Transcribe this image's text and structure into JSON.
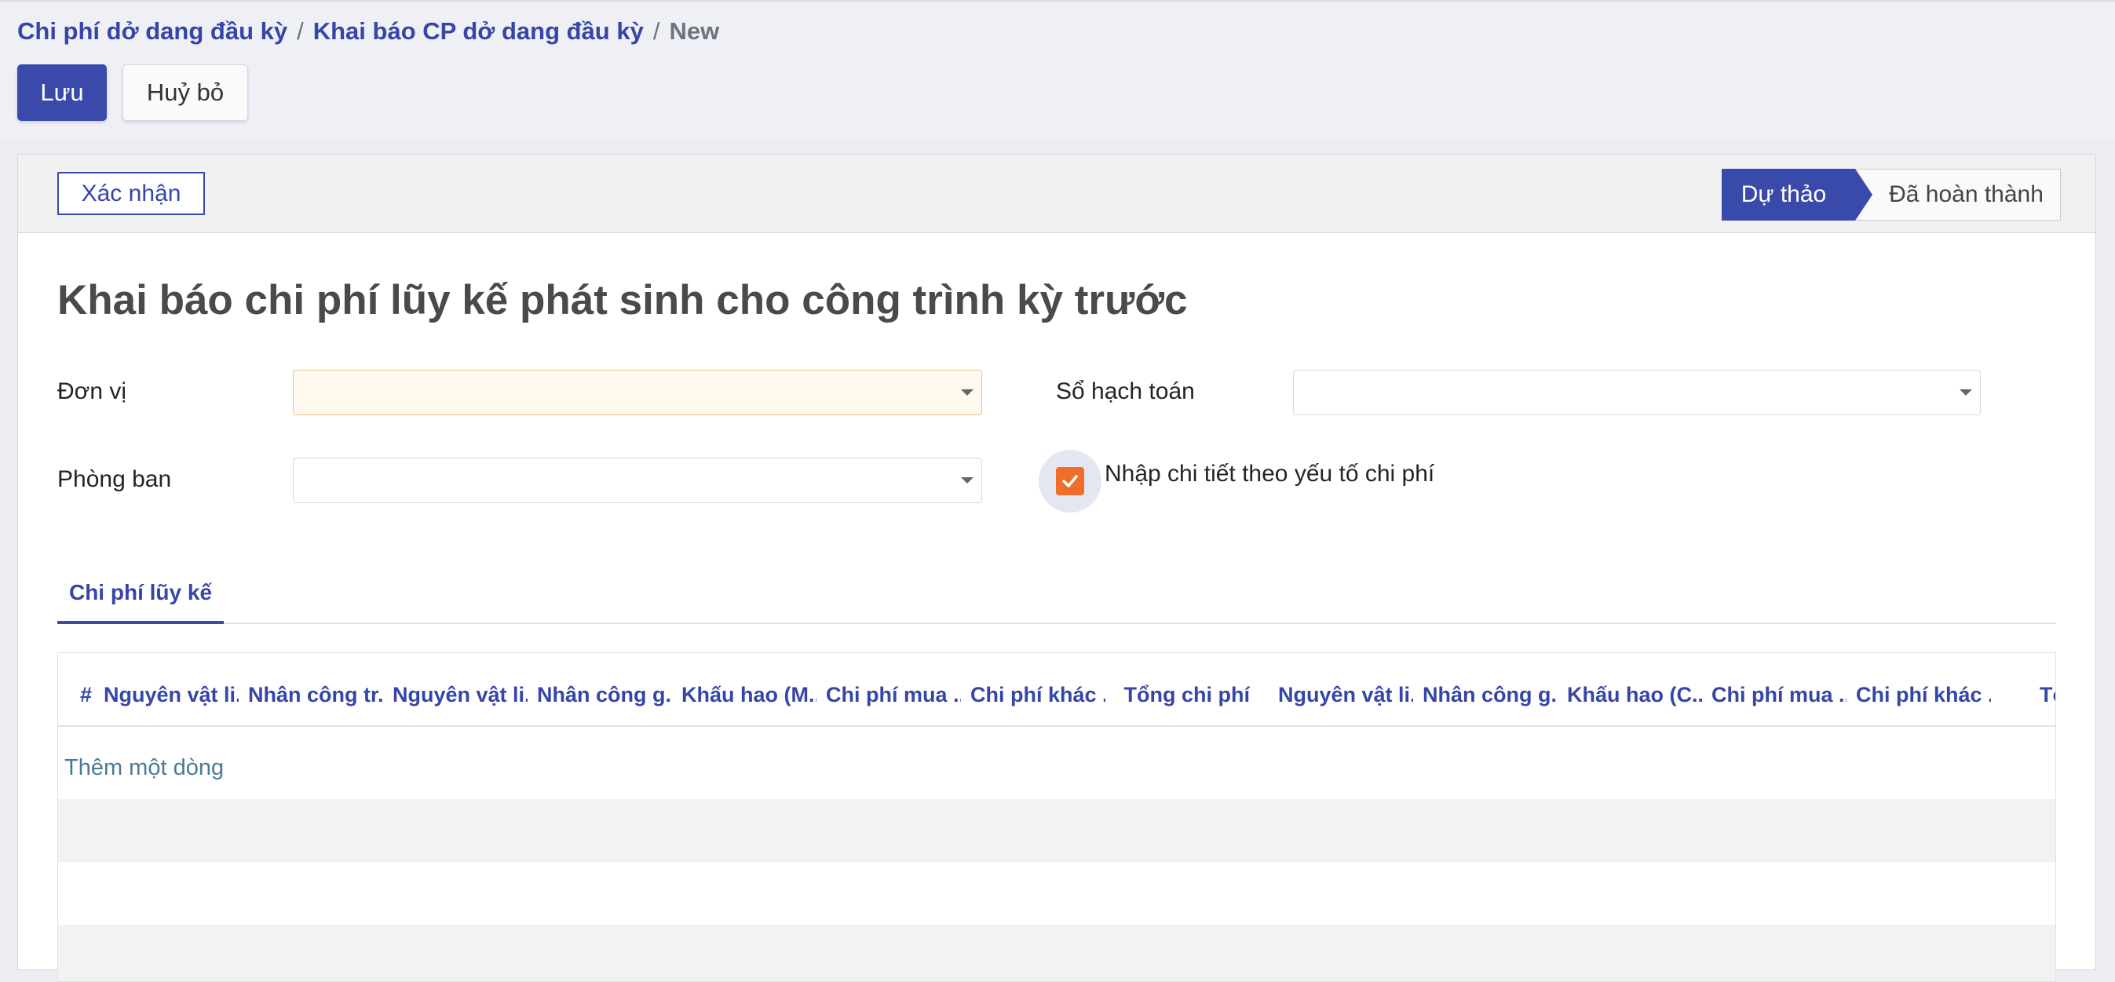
{
  "breadcrumb": {
    "items": [
      "Chi phí dở dang đầu kỳ",
      "Khai báo CP dở dang đầu kỳ"
    ],
    "separator": "/",
    "current": "New"
  },
  "toolbar": {
    "save_label": "Lưu",
    "discard_label": "Huỷ bỏ"
  },
  "statusbar": {
    "confirm_label": "Xác nhận",
    "stages": [
      "Dự thảo",
      "Đã hoàn thành"
    ],
    "active_stage": "Dự thảo"
  },
  "form": {
    "title": "Khai báo chi phí lũy kế phát sinh cho công trình kỳ trước",
    "fields": {
      "don_vi": {
        "label": "Đơn vị",
        "value": "",
        "required": true
      },
      "so_hach_toan": {
        "label": "Sổ hạch toán",
        "value": ""
      },
      "phong_ban": {
        "label": "Phòng ban",
        "value": ""
      },
      "nhap_chi_tiet": {
        "label": "Nhập chi tiết theo yếu tố chi phí",
        "checked": true
      }
    }
  },
  "tabs": [
    {
      "label": "Chi phí lũy kế",
      "active": true
    }
  ],
  "table": {
    "columns": [
      "#",
      "Nguyên vật li...",
      "Nhân công tr...",
      "Nguyên vật li...",
      "Nhân công g...",
      "Khấu hao (M...",
      "Chi phí mua ...",
      "Chi phí khác ...",
      "Tổng chi phí",
      "Nguyên vật li...",
      "Nhân công g...",
      "Khấu hao (C...",
      "Chi phí mua ...",
      "Chi phí khác ...",
      "Tổ"
    ],
    "add_line_label": "Thêm một dòng",
    "rows": []
  },
  "colors": {
    "primary": "#3a4aaa",
    "link": "#3645a8",
    "checkbox": "#ee6e2a",
    "required_field_bg": "#fff8ee"
  }
}
